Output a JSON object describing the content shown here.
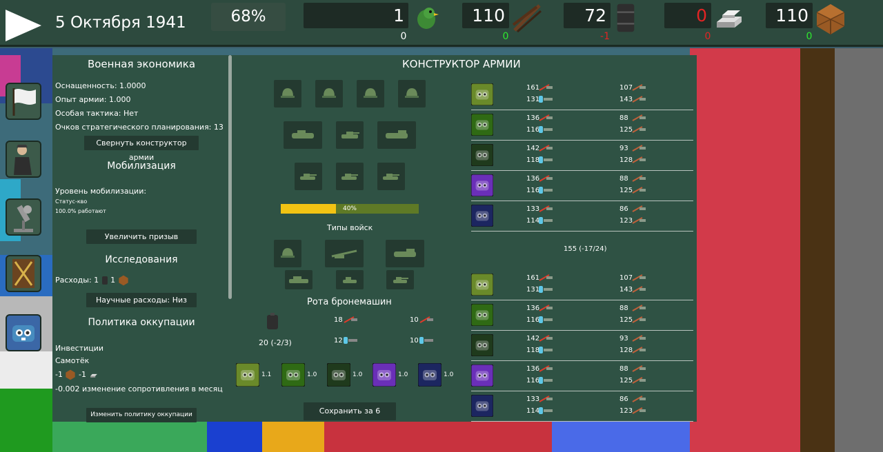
{
  "topbar": {
    "date": "5 Октября 1941",
    "percent": "68%",
    "resources": [
      {
        "name": "manpower",
        "value": "1",
        "delta": "0",
        "delta_color": "#ffffff",
        "icon": "green-bird-icon"
      },
      {
        "name": "weapons",
        "value": "110",
        "delta": "0",
        "delta_color": "#2ee82e",
        "icon": "rifles-icon"
      },
      {
        "name": "oil",
        "value": "72",
        "delta": "-1",
        "delta_color": "#e32424",
        "icon": "oil-barrel-icon"
      },
      {
        "name": "steel",
        "value": "0",
        "value_color": "#e32424",
        "delta": "0",
        "delta_color": "#e32424",
        "icon": "steel-ingots-icon"
      },
      {
        "name": "wood",
        "value": "110",
        "delta": "0",
        "delta_color": "#2ee82e",
        "icon": "wood-crate-icon"
      }
    ]
  },
  "left_panel": {
    "econ_title": "Военная экономика",
    "equipment": "Оснащенность: 1.0000",
    "experience": "Опыт армии: 1.000",
    "tactic": "Особая тактика: Нет",
    "planning": "Очков стратегического планирования: 13",
    "collapse_btn": "Свернуть конструктор армии",
    "mobil_title": "Мобилизация",
    "mobil_level": "Уровень мобилизации:",
    "status_quo": "Статус-кво",
    "working": "100.0% работают",
    "increase_btn": "Увеличить призыв",
    "research_title": "Исследования",
    "expenses": "Расходы: 1",
    "expenses_val2": "1",
    "sci_btn": "Научные расходы: Низ",
    "occupation_title": "Политика оккупации",
    "investments": "Инвестиции",
    "samotek": "Самотёк",
    "occ_cost1": "-1",
    "occ_cost2": "-1",
    "resistance": "-0.002 изменение сопротивления в месяц",
    "change_btn": "Изменить политику оккупации"
  },
  "army": {
    "title": "КОНСТРУКТОР АРМИИ",
    "progress_label": "40%",
    "progress_value": 0.4,
    "troop_types": "Типы войск",
    "company": "Рота бронемашин",
    "company_stats": {
      "a1": "18",
      "a2": "10",
      "d1": "12",
      "d2": "10"
    },
    "company_cost": "20 (-2/3)",
    "quality": [
      {
        "color": "#6a8a2a",
        "mult": "1.1"
      },
      {
        "color": "#2f6a14",
        "mult": "1.0"
      },
      {
        "color": "#1f3a1c",
        "mult": "1.0"
      },
      {
        "color": "#6a2fb8",
        "mult": "1.0"
      },
      {
        "color": "#1c2660",
        "mult": "1.0"
      }
    ],
    "save_btn": "Сохранить за  6",
    "middle_label": "155 (-17/24)",
    "stat_rows": [
      {
        "color": "#6a8a2a",
        "a1": "161",
        "a2": "131",
        "b1": "107",
        "b2": "143"
      },
      {
        "color": "#2f6a14",
        "a1": "136",
        "a2": "116",
        "b1": "88",
        "b2": "125"
      },
      {
        "color": "#1f3a1c",
        "a1": "142",
        "a2": "118",
        "b1": "93",
        "b2": "128"
      },
      {
        "color": "#6a2fb8",
        "a1": "136",
        "a2": "116",
        "b1": "88",
        "b2": "125"
      },
      {
        "color": "#1c2660",
        "a1": "133",
        "a2": "114",
        "b1": "86",
        "b2": "123"
      }
    ]
  },
  "colors": {
    "panel": "#2f5244",
    "topbar": "#2d4a3e",
    "accent_yellow": "#f2c313",
    "positive": "#2ee82e",
    "negative": "#e32424"
  }
}
